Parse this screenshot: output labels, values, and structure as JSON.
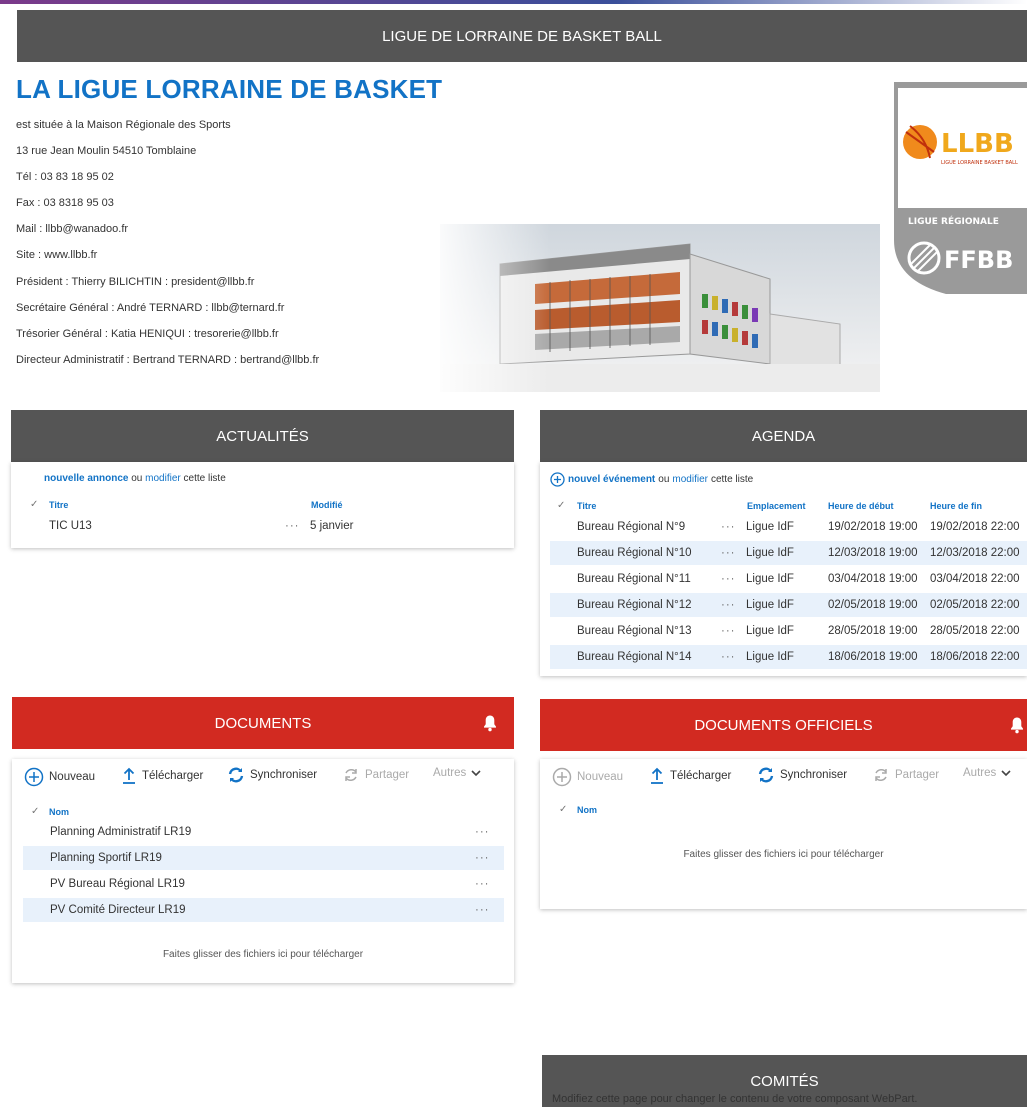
{
  "banner": {
    "title": "LIGUE DE LORRAINE DE BASKET BALL"
  },
  "intro": {
    "title": "LA LIGUE LORRAINE DE BASKET",
    "lines": [
      "est située à la Maison Régionale des Sports",
      "13 rue Jean Moulin 54510 Tomblaine",
      "Tél : 03 83 18 95 02",
      "Fax : 03 8318 95 03",
      "Mail : llbb@wanadoo.fr",
      "Site : www.llbb.fr",
      "Président : Thierry BILICHTIN : president@llbb.fr",
      "Secrétaire Général : André TERNARD : llbb@ternard.fr",
      "Trésorier Général : Katia HENIQUI : tresorerie@llbb.fr",
      "Directeur Administratif : Bertrand TERNARD : bertrand@llbb.fr"
    ]
  },
  "logo": {
    "brand": "LLBB",
    "tagline": "LIGUE LORRAINE BASKET BALL",
    "band": "LIGUE RÉGIONALE",
    "federation": "FFBB"
  },
  "actualites": {
    "title": "ACTUALITÉS",
    "new_link": "nouvelle annonce",
    "or": "ou",
    "edit_link": "modifier",
    "suffix": "cette liste",
    "columns": {
      "titre": "Titre",
      "modifie": "Modifié"
    },
    "rows": [
      {
        "titre": "TIC U13",
        "modifie": "5 janvier"
      }
    ]
  },
  "agenda": {
    "title": "AGENDA",
    "new_link": "nouvel événement",
    "or": "ou",
    "edit_link": "modifier",
    "suffix": "cette liste",
    "columns": {
      "titre": "Titre",
      "emplacement": "Emplacement",
      "debut": "Heure de début",
      "fin": "Heure de fin"
    },
    "rows": [
      {
        "titre": "Bureau Régional N°9",
        "lieu": "Ligue IdF",
        "debut": "19/02/2018 19:00",
        "fin": "19/02/2018 22:00"
      },
      {
        "titre": "Bureau Régional N°10",
        "lieu": "Ligue IdF",
        "debut": "12/03/2018 19:00",
        "fin": "12/03/2018 22:00"
      },
      {
        "titre": "Bureau Régional N°11",
        "lieu": "Ligue IdF",
        "debut": "03/04/2018 19:00",
        "fin": "03/04/2018 22:00"
      },
      {
        "titre": "Bureau Régional N°12",
        "lieu": "Ligue IdF",
        "debut": "02/05/2018 19:00",
        "fin": "02/05/2018 22:00"
      },
      {
        "titre": "Bureau Régional N°13",
        "lieu": "Ligue IdF",
        "debut": "28/05/2018 19:00",
        "fin": "28/05/2018 22:00"
      },
      {
        "titre": "Bureau Régional N°14",
        "lieu": "Ligue IdF",
        "debut": "18/06/2018 19:00",
        "fin": "18/06/2018 22:00"
      }
    ]
  },
  "toolbar": {
    "nouveau": "Nouveau",
    "telecharger": "Télécharger",
    "synchroniser": "Synchroniser",
    "partager": "Partager",
    "autres": "Autres"
  },
  "documents": {
    "title": "DOCUMENTS",
    "column": "Nom",
    "rows": [
      "Planning Administratif LR19",
      "Planning Sportif LR19",
      "PV Bureau Régional LR19",
      "PV Comité Directeur LR19"
    ],
    "drop_text": "Faites glisser des fichiers ici pour télécharger"
  },
  "documents_officiels": {
    "title": "DOCUMENTS OFFICIELS",
    "column": "Nom",
    "drop_text": "Faites glisser des fichiers ici pour télécharger"
  },
  "comites": {
    "title": "COMITÉS",
    "message": "Modifiez cette page pour changer le contenu de votre composant WebPart."
  },
  "colors": {
    "accent": "#1273c6",
    "red_header": "#d22a21",
    "gray_header": "#555555",
    "row_highlight": "#e8f1fb"
  },
  "icons": [
    "plus-circle-icon",
    "upload-arrow-icon",
    "sync-icon",
    "share-icon",
    "chevron-down-icon",
    "bell-icon",
    "check-icon",
    "more-icon"
  ]
}
